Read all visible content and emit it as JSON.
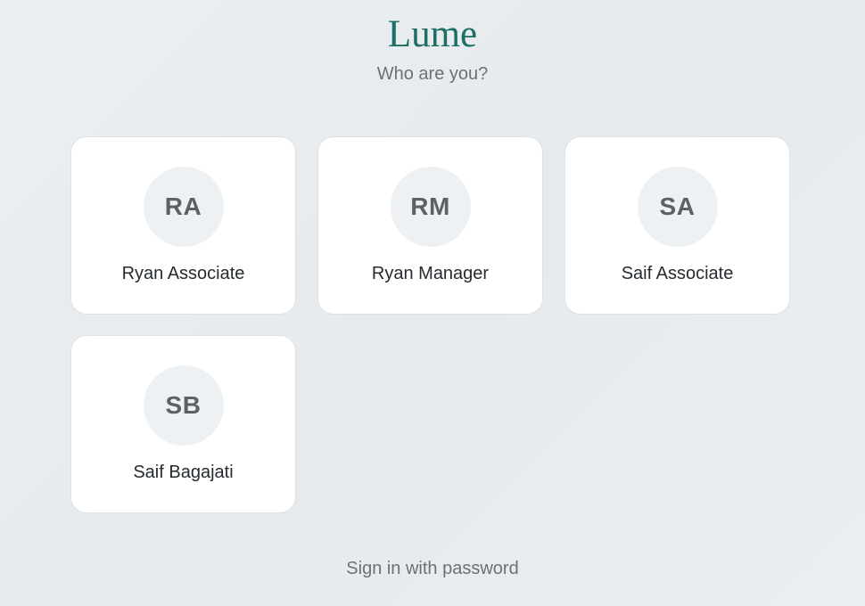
{
  "app": {
    "title": "Lume",
    "subtitle": "Who are you?"
  },
  "profiles": [
    {
      "initials": "RA",
      "name": "Ryan Associate"
    },
    {
      "initials": "RM",
      "name": "Ryan Manager"
    },
    {
      "initials": "SA",
      "name": "Saif Associate"
    },
    {
      "initials": "SB",
      "name": "Saif Bagajati"
    }
  ],
  "footer": {
    "signin_label": "Sign in with password"
  },
  "colors": {
    "brand": "#1d6f66",
    "muted_text": "#6a7177",
    "avatar_bg": "#eef1f3"
  }
}
